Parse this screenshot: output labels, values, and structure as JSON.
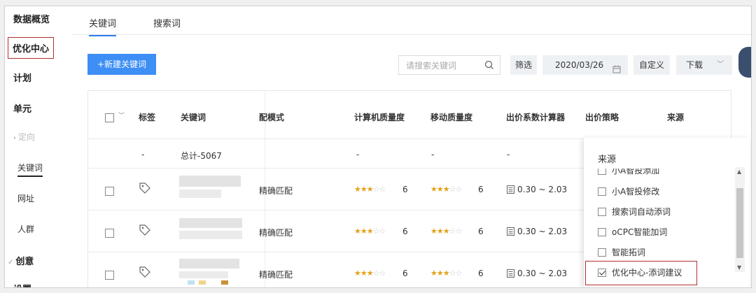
{
  "sidebar": {
    "overview": "数据概览",
    "optimize": "优化中心",
    "plan": "计划",
    "unit": "单元",
    "targeting": "定向",
    "keyword": "关键词",
    "url": "网址",
    "audience": "人群",
    "creative": "创意",
    "settings": "设置"
  },
  "tabs": [
    "关键词",
    "搜索词"
  ],
  "toolbar": {
    "new_keyword": "+新建关键词",
    "search_placeholder": "请搜索关键词",
    "filter": "筛选",
    "date": "2020/03/26",
    "custom": "自定义",
    "download": "下载"
  },
  "table": {
    "headers": [
      "标签",
      "关键词",
      "配模式",
      "计算机质量度",
      "移动质量度",
      "出价系数计算器",
      "出价策略",
      "来源"
    ],
    "summary": [
      "-",
      "总计-5067",
      "-",
      "-",
      "-"
    ],
    "rows": [
      {
        "match": "精确匹配",
        "pc_stars": 3,
        "pc_score": "6",
        "mobile_stars": 3,
        "mobile_score": "6",
        "bid_range": "0.30 ~ 2.03"
      },
      {
        "match": "精确匹配",
        "pc_stars": 3,
        "pc_score": "6",
        "mobile_stars": 3,
        "mobile_score": "6",
        "bid_range": "0.30 ~ 2.03"
      },
      {
        "match": "精确匹配",
        "pc_stars": 3,
        "pc_score": "6",
        "mobile_stars": 3,
        "mobile_score": "6",
        "bid_range": "0.30 ~ 2.03"
      }
    ]
  },
  "source_filter": {
    "title": "来源",
    "options": [
      {
        "label": "小A智投添加",
        "checked": false
      },
      {
        "label": "小A智投修改",
        "checked": false
      },
      {
        "label": "搜索词自动添词",
        "checked": false
      },
      {
        "label": "oCPC智能加词",
        "checked": false
      },
      {
        "label": "智能拓词",
        "checked": false
      },
      {
        "label": "优化中心-添词建议",
        "checked": true
      }
    ]
  },
  "colors": {
    "accent": "#3d8ef5",
    "highlight_border": "#b03030",
    "star": "#e3a21a"
  }
}
